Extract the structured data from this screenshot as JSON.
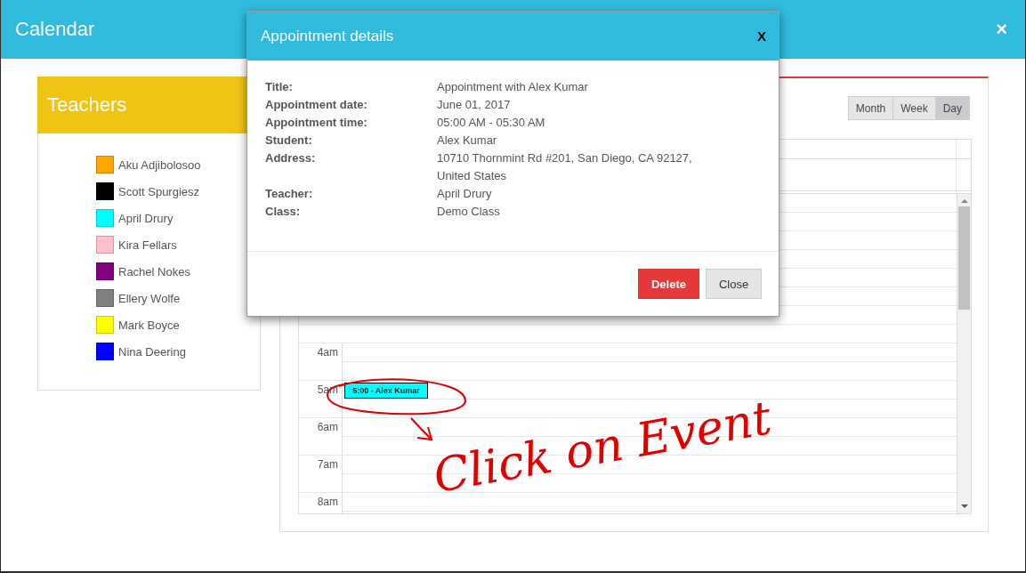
{
  "window": {
    "title": "Calendar",
    "close": "×"
  },
  "teachers": {
    "title": "Teachers",
    "items": [
      {
        "name": "Aku Adjibolosoo",
        "color": "#ffa500"
      },
      {
        "name": "Scott Spurgiesz",
        "color": "#000000"
      },
      {
        "name": "April Drury",
        "color": "#00ffff"
      },
      {
        "name": "Kira Fellars",
        "color": "#ffc0cb"
      },
      {
        "name": "Rachel Nokes",
        "color": "#800080"
      },
      {
        "name": "Ellery Wolfe",
        "color": "#808080"
      },
      {
        "name": "Mark Boyce",
        "color": "#ffff00"
      },
      {
        "name": "Nina Deering",
        "color": "#0000ff"
      }
    ]
  },
  "calendar": {
    "views": [
      {
        "label": "Month",
        "selected": false
      },
      {
        "label": "Week",
        "selected": false
      },
      {
        "label": "Day",
        "selected": true
      }
    ],
    "time_rows": [
      {
        "label": "4am"
      },
      {
        "label": "5am",
        "event": {
          "label": "5:00 - Alex Kumar",
          "color": "#00ffff"
        }
      },
      {
        "label": "6am"
      },
      {
        "label": "7am"
      },
      {
        "label": "8am"
      }
    ]
  },
  "dialog": {
    "title": "Appointment details",
    "close": "X",
    "fields": [
      {
        "label": "Title:",
        "value_lines": [
          "Appointment with Alex Kumar"
        ]
      },
      {
        "label": "Appointment date:",
        "value_lines": [
          "June 01, 2017"
        ]
      },
      {
        "label": "Appointment time:",
        "value_lines": [
          "05:00 AM - 05:30 AM"
        ]
      },
      {
        "label": "Student:",
        "value_lines": [
          "Alex Kumar"
        ]
      },
      {
        "label": "Address:",
        "value_lines": [
          "10710 Thornmint Rd #201, San Diego, CA 92127,",
          "United States"
        ]
      },
      {
        "label": "Teacher:",
        "value_lines": [
          "April Drury"
        ]
      },
      {
        "label": "Class:",
        "value_lines": [
          "Demo Class"
        ]
      }
    ],
    "buttons": [
      {
        "label": "Delete",
        "kind": "danger"
      },
      {
        "label": "Close",
        "kind": "default"
      }
    ]
  },
  "annotation": {
    "text": "Click on Event"
  }
}
